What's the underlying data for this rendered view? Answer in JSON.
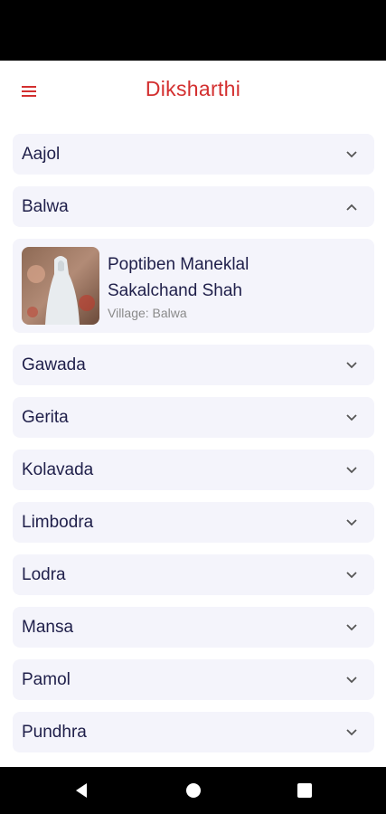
{
  "app_bar": {
    "title": "Diksharthi"
  },
  "villages": [
    {
      "label": "Aajol"
    },
    {
      "label": "Balwa"
    },
    {
      "label": "Gawada"
    },
    {
      "label": "Gerita"
    },
    {
      "label": "Kolavada"
    },
    {
      "label": "Limbodra"
    },
    {
      "label": "Lodra"
    },
    {
      "label": "Mansa"
    },
    {
      "label": "Pamol"
    },
    {
      "label": "Pundhra"
    }
  ],
  "expanded_card": {
    "name_line1": "Poptiben Maneklal",
    "name_line2": "Sakalchand Shah",
    "village": "Village: Balwa"
  },
  "colors": {
    "accent": "#d32f2f",
    "item_bg": "#f4f4fb",
    "text": "#1f1f4a"
  },
  "icons": {
    "menu": "hamburger-icon",
    "collapsed": "chevron-down-icon",
    "expanded": "chevron-up-icon"
  }
}
